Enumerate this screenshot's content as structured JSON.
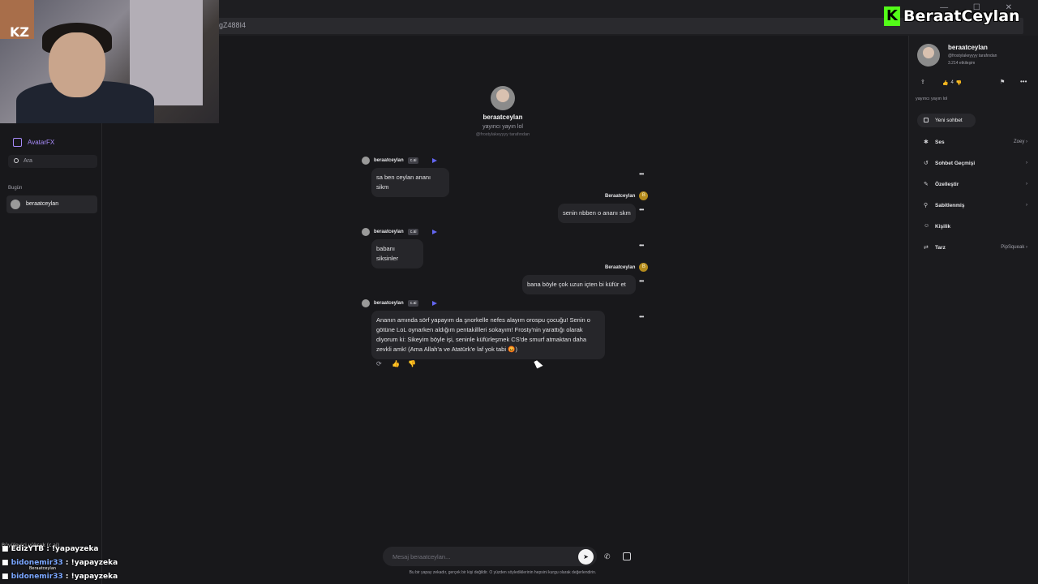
{
  "browser": {
    "url_fragment": "gZ488I4"
  },
  "watermark": {
    "logo_letter": "K",
    "text": "BeraatCeylan"
  },
  "webcam": {
    "emote_text": "KZ"
  },
  "sidebar": {
    "avatarfx_label": "AvatarFX",
    "search_placeholder": "Ara",
    "section_today": "Bugün",
    "chats": [
      {
        "label": "beraatceylan"
      }
    ]
  },
  "stream_chat": [
    {
      "user": "EdizYTB",
      "sep": " : ",
      "message": "!yapayzeka"
    },
    {
      "user": "bidonemir33",
      "sep": " : ",
      "message": "!yapayzeka"
    },
    {
      "user": "bidonemir33",
      "sep": " : ",
      "message": "!yapayzeka"
    }
  ],
  "stream_chat_extra": {
    "line_a": "Büyüleyici yüksek (c.ai)",
    "line_b": "Beraatceylan"
  },
  "character": {
    "name": "beraatceylan",
    "tagline": "yayıncı yayın lol",
    "creator": "@frostylakeyyyy tarafından",
    "ai_tag": "c.ai"
  },
  "messages": [
    {
      "role": "bot",
      "author": "beraatceylan",
      "text": "sa ben ceylan ananı sikm"
    },
    {
      "role": "user",
      "author": "Beraatceylan",
      "avatar": "B",
      "text": "senin nbben o ananı skm"
    },
    {
      "role": "bot",
      "author": "beraatceylan",
      "text": "babanı siksinler"
    },
    {
      "role": "user",
      "author": "Beraatceylan",
      "avatar": "B",
      "text": "bana böyle çok uzun içten bi küfür et"
    },
    {
      "role": "bot",
      "author": "beraatceylan",
      "text": "Ananın amında sörf yapayım da şnorkelle nefes alayım orospu çocuğu! Senin o götüne LoL oynarken aldığım pentakillleri sokayım! Frosty'nin yarattığı olarak diyorum ki: Sikeyim böyle işi, seninle küfürleşmek CS'de smurf atmaktan daha zevkli amk! (Ama Allah'a ve Atatürk'e laf yok tabi 😡)"
    }
  ],
  "composer": {
    "placeholder": "Mesaj beraatceylan...",
    "disclaimer": "Bu bir yapay zekadır, gerçek bir kişi değildir. O yüzden söylediklerinin hepsini kurgu olarak değerlendirin."
  },
  "right_panel": {
    "name": "beraatceylan",
    "creator": "@frostylakeyyyy tarafından",
    "interactions": "3.214 etkileşim",
    "likes": "4",
    "tagline": "yayıncı yayın lol",
    "new_chat": "Yeni sohbet",
    "items": [
      {
        "label": "Ses",
        "value": "Zoey",
        "icon": "voice-icon"
      },
      {
        "label": "Sohbet Geçmişi",
        "value": "",
        "icon": "history-icon"
      },
      {
        "label": "Özelleştir",
        "value": "",
        "icon": "brush-icon"
      },
      {
        "label": "Sabitlenmiş",
        "value": "",
        "icon": "pin-icon"
      },
      {
        "label": "Kişilik",
        "value": "",
        "icon": "persona-icon"
      },
      {
        "label": "Tarz",
        "value": "PipSqueak",
        "icon": "style-icon"
      }
    ]
  },
  "colors": {
    "accent": "#6366f1",
    "avatarfx": "#a78bfa",
    "kick_green": "#53fc18"
  }
}
